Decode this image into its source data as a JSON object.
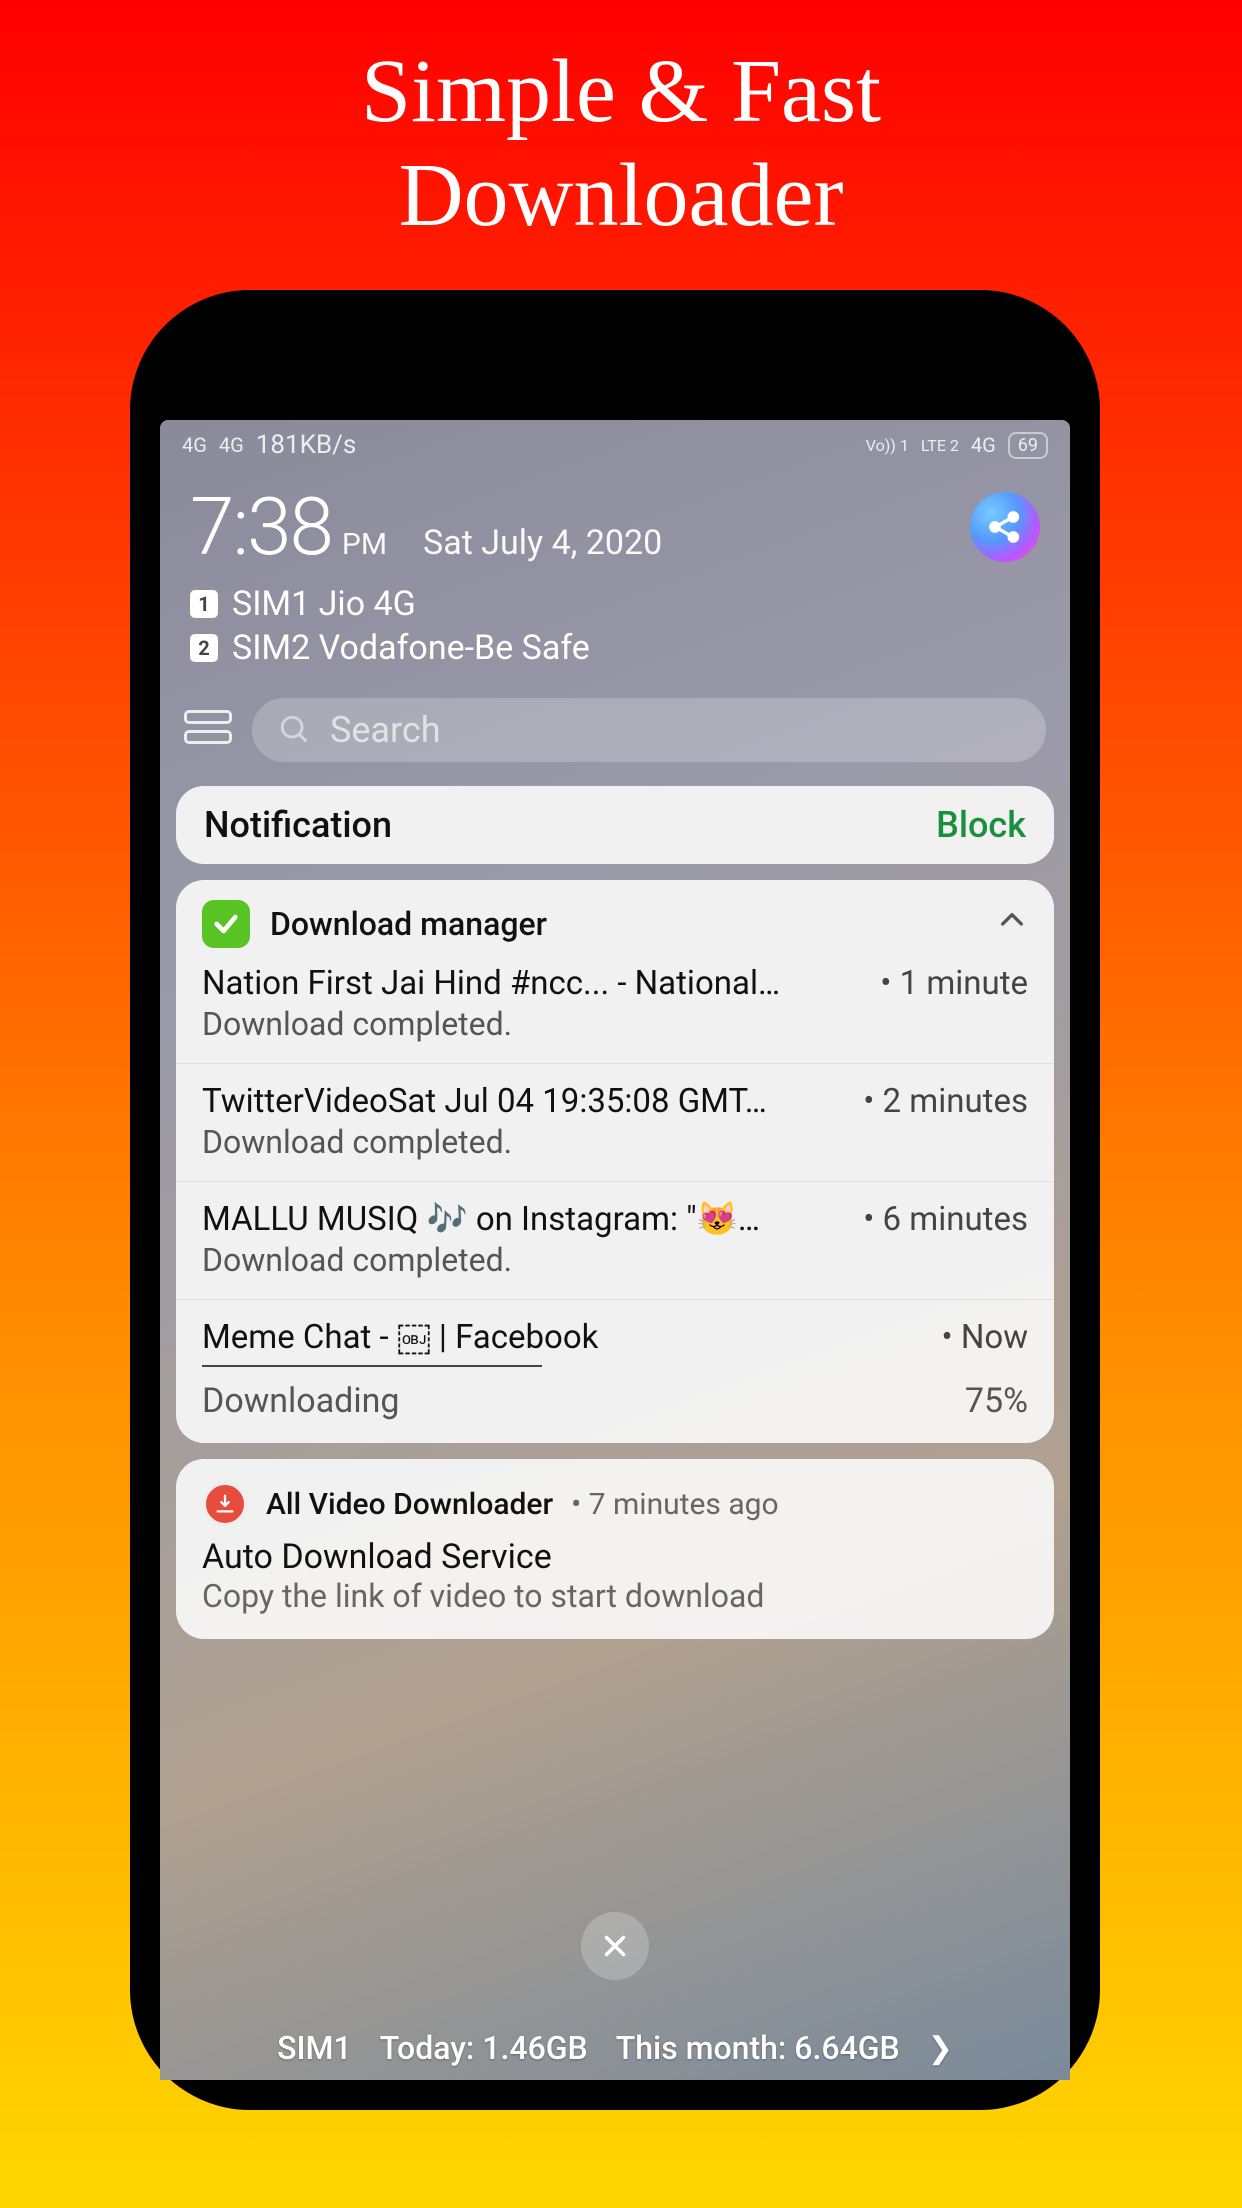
{
  "headline": "Simple & Fast\nDownloader",
  "statusbar": {
    "left_4g_a": "4G",
    "left_4g_b": "4G",
    "speed": "181KB/s",
    "right_volte": "Vo)) 1",
    "right_lte": "LTE 2",
    "right_4g": "4G",
    "battery": "69"
  },
  "clock": {
    "time": "7:38",
    "ampm": "PM",
    "date": "Sat July 4, 2020"
  },
  "sims": [
    {
      "chip": "1",
      "label": "SIM1 Jio 4G"
    },
    {
      "chip": "2",
      "label": "SIM2 Vodafone-Be Safe"
    }
  ],
  "search": {
    "placeholder": "Search"
  },
  "notif_header": {
    "title": "Notification",
    "block": "Block"
  },
  "download_manager": {
    "app_name": "Download manager",
    "items": [
      {
        "title": "Nation First Jai Hind #ncc... - National…",
        "time": "• 1 minute",
        "sub": "Download completed."
      },
      {
        "title": "TwitterVideoSat Jul 04 19:35:08 GMT…",
        "time": "• 2 minutes",
        "sub": "Download completed."
      },
      {
        "title": "MALLU MUSIQ 🎶 on Instagram: \"😻…",
        "time": "• 6 minutes",
        "sub": "Download completed."
      },
      {
        "title": "Meme Chat - ￼ | Facebook",
        "time": "• Now",
        "sub": ""
      }
    ],
    "progress_label": "Downloading",
    "progress_value": "75%"
  },
  "avd": {
    "app_name": "All Video Downloader",
    "time": "• 7 minutes ago",
    "title": "Auto Download Service",
    "sub": "Copy the link of video to start download"
  },
  "data_usage": {
    "sim": "SIM1",
    "today": "Today: 1.46GB",
    "month": "This month: 6.64GB"
  }
}
